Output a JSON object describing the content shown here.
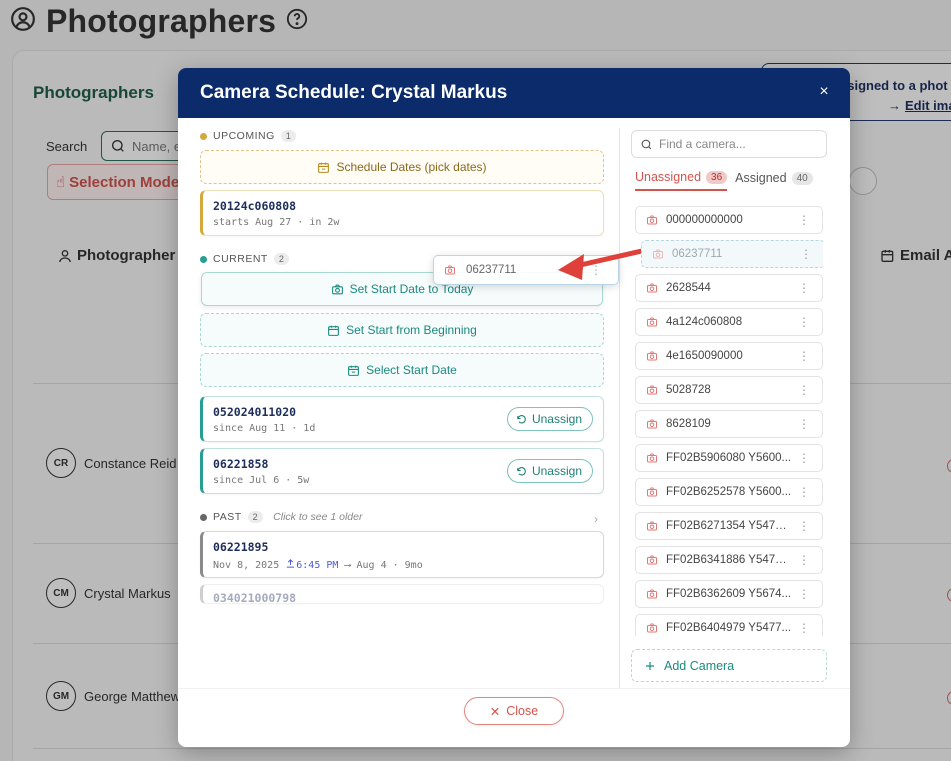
{
  "page": {
    "title": "Photographers",
    "card_title": "Photographers",
    "banner_line1": "ssigned to a phot",
    "banner_line2": "Edit ima",
    "search_label": "Search",
    "search_placeholder": "Name, e",
    "selection_mode_label": "Selection Mode",
    "col_photographer": "Photographer",
    "col_email": "Email A",
    "rows": [
      {
        "initials": "CR",
        "name": "Constance Reid"
      },
      {
        "initials": "CM",
        "name": "Crystal Markus"
      },
      {
        "initials": "GM",
        "name": "George Matthews"
      }
    ]
  },
  "modal": {
    "title": "Camera Schedule: Crystal Markus",
    "upcoming": {
      "label": "UPCOMING",
      "count": "1",
      "schedule_btn": "Schedule Dates (pick dates)",
      "cards": [
        {
          "id": "20124c060808",
          "sub": "starts Aug 27 · in 2w"
        }
      ]
    },
    "current": {
      "label": "CURRENT",
      "count": "2",
      "btn_today": "Set Start Date to Today",
      "btn_beginning": "Set Start from Beginning",
      "btn_select": "Select Start Date",
      "cards": [
        {
          "id": "052024011020",
          "sub": "since Aug 11 · 1d",
          "action": "Unassign"
        },
        {
          "id": "06221858",
          "sub": "since Jul 6 · 5w",
          "action": "Unassign"
        }
      ]
    },
    "past": {
      "label": "PAST",
      "count": "2",
      "hint": "Click to see 1 older",
      "cards": [
        {
          "id": "06221895",
          "date": "Nov 8, 2025",
          "time": "6:45 PM",
          "sub_rest": "⟶ Aug 4 · 9mo"
        },
        {
          "id": "034021000798"
        }
      ]
    },
    "drag_ghost": "06237711",
    "find_placeholder": "Find a camera...",
    "tabs": [
      {
        "label": "Unassigned",
        "count": "36"
      },
      {
        "label": "Assigned",
        "count": "40"
      }
    ],
    "cameras": [
      "000000000000",
      "06237711",
      "2628544",
      "4a124c060808",
      "4e1650090000",
      "5028728",
      "8628109",
      "FF02B5906080 Y5600...",
      "FF02B6252578 Y5600...",
      "FF02B6271354 Y54772 ...",
      "FF02B6341886 Y54772...",
      "FF02B6362609 Y5674...",
      "FF02B6404979 Y5477..."
    ],
    "add_camera": "Add Camera",
    "close": "Close",
    "close_x": "×"
  },
  "colors": {
    "header_navy": "#0c2b6b",
    "teal": "#1b8a80",
    "gold": "#d4a93c",
    "danger": "#d5534d"
  }
}
